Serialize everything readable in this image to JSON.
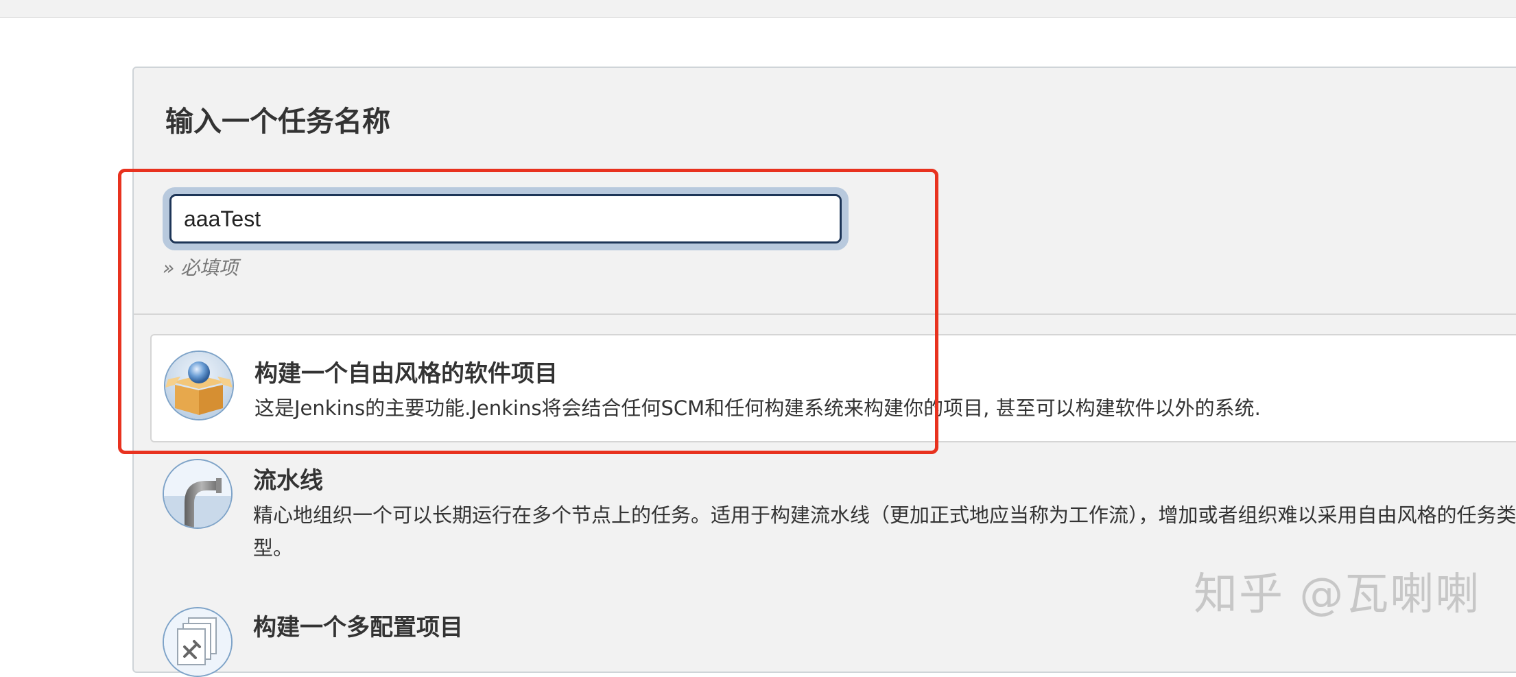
{
  "form": {
    "title": "输入一个任务名称",
    "name_value": "aaaTest",
    "required_hint": "» 必填项"
  },
  "job_types": [
    {
      "name": "构建一个自由风格的软件项目",
      "description": "这是Jenkins的主要功能.Jenkins将会结合任何SCM和任何构建系统来构建你的项目, 甚至可以构建软件以外的系统.",
      "icon": "freestyle-box-icon",
      "selected": true
    },
    {
      "name": "流水线",
      "description": "精心地组织一个可以长期运行在多个节点上的任务。适用于构建流水线（更加正式地应当称为工作流），增加或者组织难以采用自由风格的任务类型。",
      "icon": "pipeline-pipe-icon",
      "selected": false
    },
    {
      "name": "构建一个多配置项目",
      "icon": "multi-config-icon",
      "selected": false
    }
  ],
  "annotation": {
    "highlight_color": "#e8321f"
  },
  "watermark": {
    "text": "知乎 @瓦喇喇"
  },
  "colors": {
    "panel_bg": "#f2f2f2",
    "input_border": "#1d3557",
    "input_focus_ring": "#b8c9dd"
  }
}
